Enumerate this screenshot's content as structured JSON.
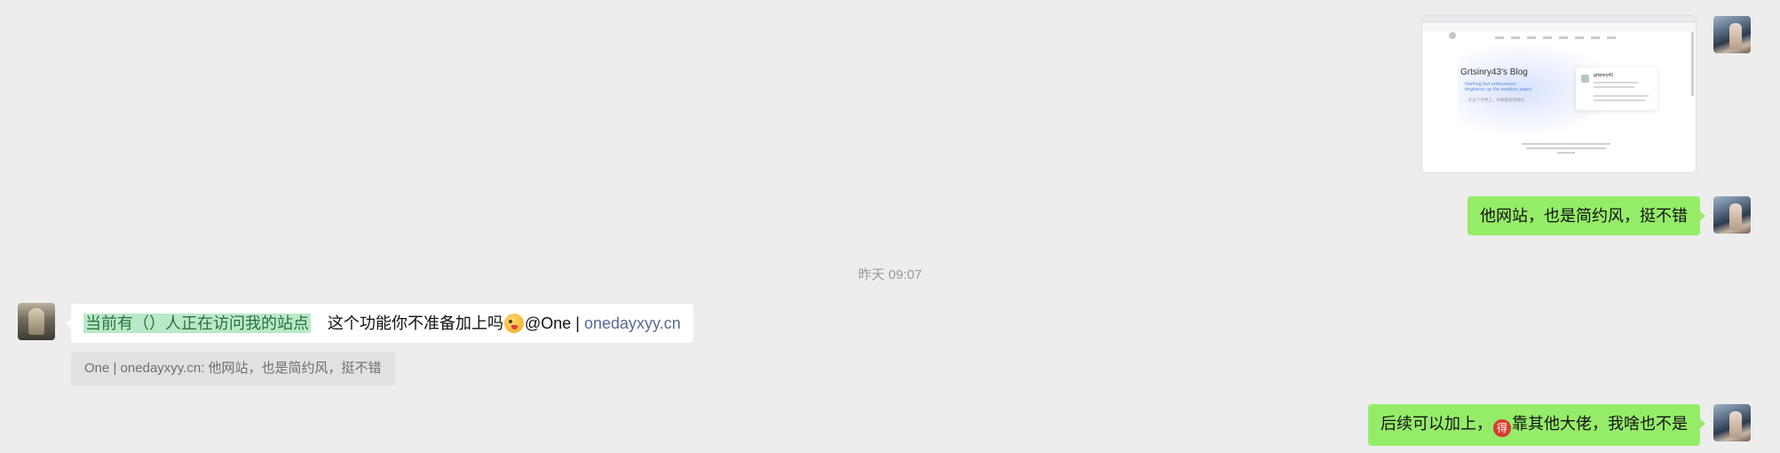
{
  "colors": {
    "background": "#ededed",
    "bubble_self": "#95ec69",
    "bubble_other": "#ffffff",
    "quote_bg": "#e1e1e1",
    "link": "#576b95",
    "highlight": "#b9e9c6"
  },
  "screenshot_message": {
    "blog_title": "Grtsinry43's Blog",
    "blog_subtitle": "Nothing but enthusiasm brightens up the endless years.",
    "blog_line": "在这个世界上，你我都是独特的",
    "card_name": "grtsinry43"
  },
  "messages": {
    "m1": {
      "text": "他网站，也是简约风，挺不错"
    },
    "timestamp": "昨天 09:07",
    "m2": {
      "highlight": "当前有（）人正在访问我的站点",
      "text": "这个功能你不准备加上吗",
      "emoji": "wink-tongue-emoji",
      "mention": "@One | ",
      "link": "onedayxyy.cn"
    },
    "quote": "One | onedayxyy.cn: 他网站，也是简约风，挺不错",
    "m3": {
      "part1": "后续可以加上，",
      "emoji_glyph": "得",
      "part2": "靠其他大佬，我啥也不是"
    }
  }
}
